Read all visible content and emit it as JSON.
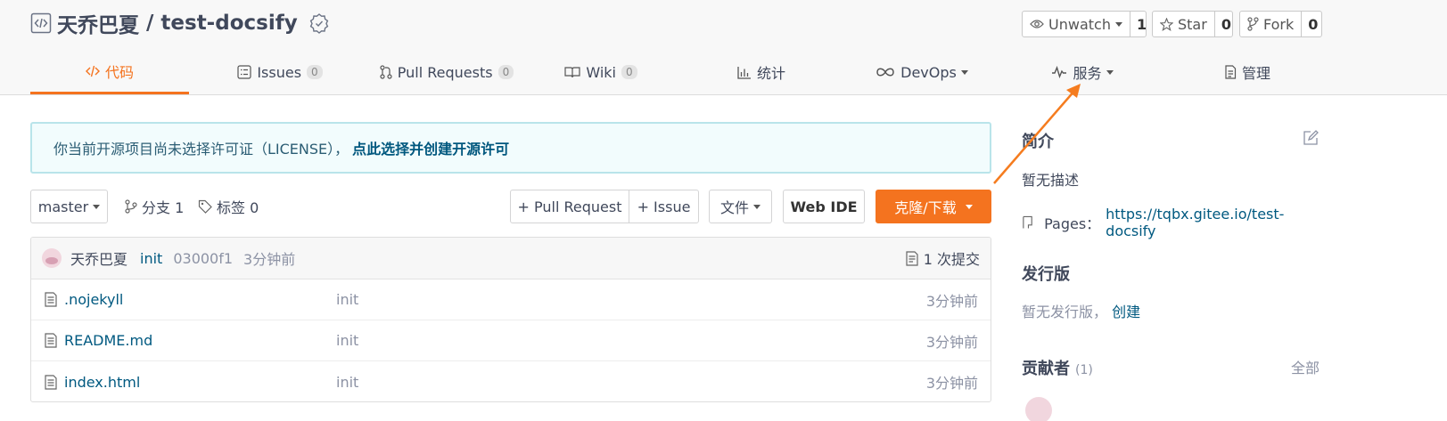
{
  "repo": {
    "owner": "天乔巴夏",
    "separator": "/",
    "name": "test-docsify"
  },
  "social": {
    "unwatch_label": "Unwatch",
    "unwatch_count": "1",
    "star_label": "Star",
    "star_count": "0",
    "fork_label": "Fork",
    "fork_count": "0"
  },
  "tabs": [
    {
      "label": "代码",
      "icon": "code-icon",
      "active": true
    },
    {
      "label": "Issues",
      "count": "0",
      "icon": "issues-icon"
    },
    {
      "label": "Pull Requests",
      "count": "0",
      "icon": "pull-request-icon"
    },
    {
      "label": "Wiki",
      "count": "0",
      "icon": "wiki-icon"
    },
    {
      "label": "统计",
      "icon": "chart-icon"
    },
    {
      "label": "DevOps",
      "icon": "infinity-icon",
      "dropdown": true
    },
    {
      "label": "服务",
      "icon": "pulse-icon",
      "dropdown": true
    },
    {
      "label": "管理",
      "icon": "manage-icon"
    }
  ],
  "notice": {
    "text": "你当前开源项目尚未选择许可证（LICENSE），",
    "link": "点此选择并创建开源许可"
  },
  "toolbar": {
    "branch": "master",
    "branches": "分支 1",
    "tags": "标签 0",
    "pull_request": "+ Pull Request",
    "issue": "+ Issue",
    "file": "文件",
    "web_ide": "Web IDE",
    "clone": "克隆/下载"
  },
  "commit": {
    "author": "天乔巴夏",
    "message": "init",
    "hash": "03000f1",
    "time": "3分钟前",
    "commits": "1 次提交"
  },
  "files": [
    {
      "name": ".nojekyll",
      "message": "init",
      "time": "3分钟前"
    },
    {
      "name": "README.md",
      "message": "init",
      "time": "3分钟前"
    },
    {
      "name": "index.html",
      "message": "init",
      "time": "3分钟前"
    }
  ],
  "sidebar": {
    "intro_title": "简介",
    "intro_text": "暂无描述",
    "pages_label": "Pages：",
    "pages_url": "https://tqbx.gitee.io/test-docsify",
    "releases_title": "发行版",
    "releases_text": "暂无发行版，",
    "releases_link": "创建",
    "contributors_title": "贡献者",
    "contributors_count": "(1)",
    "contributors_all": "全部"
  },
  "colors": {
    "accent": "#f4731f",
    "link": "#005980",
    "annotation_arrow": "#f57c1f"
  }
}
